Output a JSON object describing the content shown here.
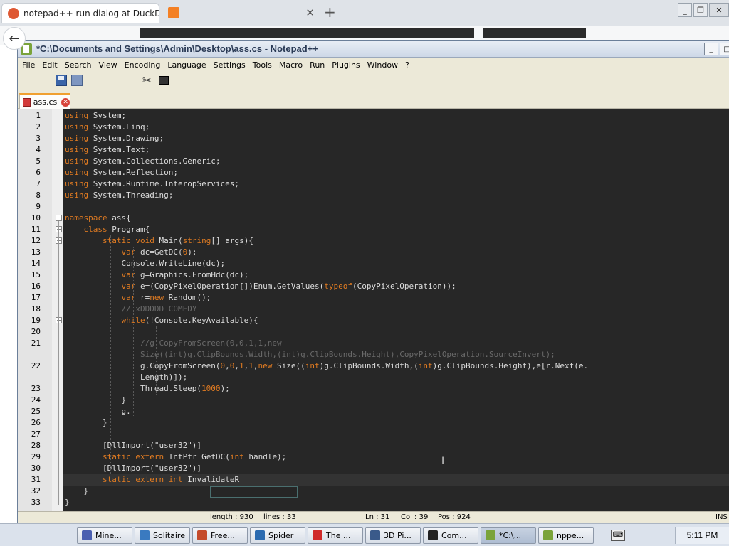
{
  "browser": {
    "tabs": [
      {
        "label": "notepad++ run dialog at DuckDuc",
        "close": "✕"
      },
      {
        "label": "",
        "close": "✕"
      }
    ],
    "new_tab": "+",
    "back": "←"
  },
  "notepad": {
    "title": "*C:\\Documents and Settings\\Admin\\Desktop\\ass.cs - Notepad++",
    "menu": [
      "File",
      "Edit",
      "Search",
      "View",
      "Encoding",
      "Language",
      "Settings",
      "Tools",
      "Macro",
      "Run",
      "Plugins",
      "Window",
      "?"
    ],
    "file_tab": "ass.cs",
    "status": {
      "length": "length : 930",
      "lines": "lines : 33",
      "ln": "Ln : 31",
      "col": "Col : 39",
      "pos": "Pos : 924",
      "ins": "INS"
    },
    "code_lines": [
      {
        "n": "1",
        "html": "<span class='kw'>using</span> System;"
      },
      {
        "n": "2",
        "html": "<span class='kw'>using</span> System.Linq;"
      },
      {
        "n": "3",
        "html": "<span class='kw'>using</span> System.Drawing;"
      },
      {
        "n": "4",
        "html": "<span class='kw'>using</span> System.Text;"
      },
      {
        "n": "5",
        "html": "<span class='kw'>using</span> System.Collections.Generic;"
      },
      {
        "n": "6",
        "html": "<span class='kw'>using</span> System.Reflection;"
      },
      {
        "n": "7",
        "html": "<span class='kw'>using</span> System.Runtime.InteropServices;"
      },
      {
        "n": "8",
        "html": "<span class='kw'>using</span> System.Threading;"
      },
      {
        "n": "9",
        "html": ""
      },
      {
        "n": "10",
        "html": "<span class='kw'>namespace</span> ass{"
      },
      {
        "n": "11",
        "html": "    <span class='kw'>class</span> Program{"
      },
      {
        "n": "12",
        "html": "        <span class='kw'>static</span> <span class='kw'>void</span> Main(<span class='kw'>string</span>[] args){"
      },
      {
        "n": "13",
        "html": "            <span class='kw'>var</span> dc=GetDC(<span class='nm'>0</span>);"
      },
      {
        "n": "14",
        "html": "            Console.WriteLine(dc);"
      },
      {
        "n": "15",
        "html": "            <span class='kw'>var</span> g=Graphics.FromHdc(dc);"
      },
      {
        "n": "16",
        "html": "            <span class='kw'>var</span> e=(CopyPixelOperation[])Enum.GetValues(<span class='kw'>typeof</span>(CopyPixelOperation));"
      },
      {
        "n": "17",
        "html": "            <span class='kw'>var</span> r=<span class='kw'>new</span> Random();"
      },
      {
        "n": "18",
        "html": "            <span class='cm'>// xDDDDD COMEDY</span>"
      },
      {
        "n": "19",
        "html": "            <span class='kw'>while</span>(!Console.KeyAvailable){"
      },
      {
        "n": "20",
        "html": ""
      },
      {
        "n": "21",
        "html": "                <span class='cm'>//g.CopyFromScreen(0,0,1,1,new</span>"
      },
      {
        "n": "",
        "html": "                <span class='cm'>Size((int)g.ClipBounds.Width,(int)g.ClipBounds.Height),CopyPixelOperation.SourceInvert);</span>"
      },
      {
        "n": "22",
        "html": "                g.CopyFromScreen(<span class='nm'>0</span>,<span class='nm'>0</span>,<span class='nm'>1</span>,<span class='nm'>1</span>,<span class='kw'>new</span> Size((<span class='kw'>int</span>)g.ClipBounds.Width,(<span class='kw'>int</span>)g.ClipBounds.Height),e[r.Next(e."
      },
      {
        "n": "",
        "html": "                Length)]);"
      },
      {
        "n": "23",
        "html": "                Thread.Sleep(<span class='nm'>1000</span>);"
      },
      {
        "n": "24",
        "html": "            }"
      },
      {
        "n": "25",
        "html": "            g."
      },
      {
        "n": "26",
        "html": "        }"
      },
      {
        "n": "27",
        "html": ""
      },
      {
        "n": "28",
        "html": "        [DllImport(\"user32\")]"
      },
      {
        "n": "29",
        "html": "        <span class='kw'>static</span> <span class='kw'>extern</span> IntPtr GetDC(<span class='kw'>int</span> handle);"
      },
      {
        "n": "30",
        "html": "        [DllImport(\"user32\")]"
      },
      {
        "n": "31",
        "html": "        <span class='kw'>static</span> <span class='kw'>extern</span> <span class='kw'>int</span> InvalidateR"
      },
      {
        "n": "32",
        "html": "    }"
      },
      {
        "n": "33",
        "html": "}"
      }
    ]
  },
  "taskbar": {
    "items": [
      {
        "label": "Mine...",
        "color": "#4a5fb0"
      },
      {
        "label": "Solitaire",
        "color": "#3a7ac0"
      },
      {
        "label": "Free...",
        "color": "#c44a2a"
      },
      {
        "label": "Spider",
        "color": "#2a6ab0"
      },
      {
        "label": "The ...",
        "color": "#d02a2a"
      },
      {
        "label": "3D Pi...",
        "color": "#3a5a8a"
      },
      {
        "label": "Com...",
        "color": "#222222"
      },
      {
        "label": "*C:\\...",
        "color": "#7aa33a"
      },
      {
        "label": "nppe...",
        "color": "#7aa33a"
      }
    ],
    "time": "5:11 PM"
  }
}
